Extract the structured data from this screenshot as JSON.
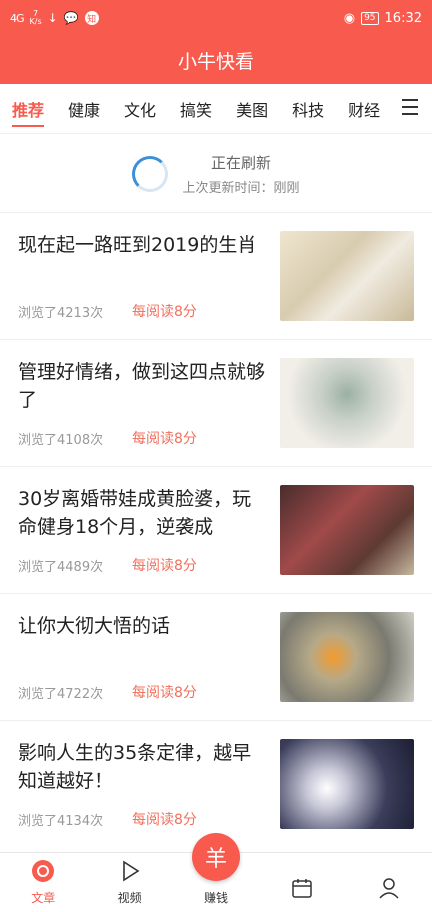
{
  "status": {
    "signal": "4G",
    "net_speed": "7",
    "net_unit": "K/s",
    "app_badge": "知",
    "battery": "95",
    "time": "16:32"
  },
  "app": {
    "title": "小牛快看"
  },
  "tabs": [
    {
      "label": "推荐",
      "active": true
    },
    {
      "label": "健康"
    },
    {
      "label": "文化"
    },
    {
      "label": "搞笑"
    },
    {
      "label": "美图"
    },
    {
      "label": "科技"
    },
    {
      "label": "财经"
    }
  ],
  "refresh": {
    "main": "正在刷新",
    "sub": "上次更新时间：刚刚"
  },
  "articles": [
    {
      "title": "现在起一路旺到2019的生肖",
      "views": "浏览了4213次",
      "reward": "每阅读8分"
    },
    {
      "title": "管理好情绪，做到这四点就够了",
      "views": "浏览了4108次",
      "reward": "每阅读8分"
    },
    {
      "title": "30岁离婚带娃成黄脸婆，玩命健身18个月，逆袭成",
      "views": "浏览了4489次",
      "reward": "每阅读8分"
    },
    {
      "title": "让你大彻大悟的话",
      "views": "浏览了4722次",
      "reward": "每阅读8分"
    },
    {
      "title": "影响人生的35条定律，越早知道越好！",
      "views": "浏览了4134次",
      "reward": "每阅读8分"
    }
  ],
  "nav": {
    "article": "文章",
    "video": "视频",
    "earn": "赚钱",
    "earn_icon": "羊",
    "task": "",
    "mine": ""
  },
  "colors": {
    "accent": "#f85a4e",
    "reward": "#f0705e"
  }
}
